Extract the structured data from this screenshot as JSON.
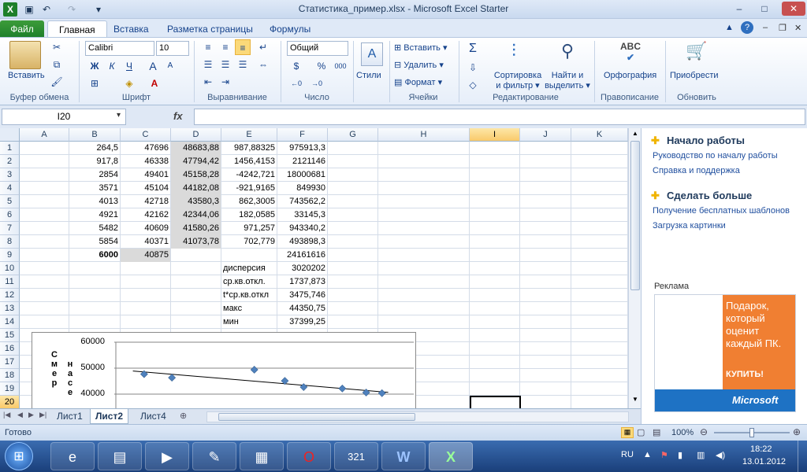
{
  "window": {
    "title": "Статистика_пример.xlsx - Microsoft Excel Starter",
    "minimize": "–",
    "maximize": "□",
    "close": "✕"
  },
  "ribbon_tabs": {
    "file": "Файл",
    "home": "Главная",
    "insert": "Вставка",
    "page_layout": "Разметка страницы",
    "formulas": "Формулы"
  },
  "ribbon": {
    "clipboard": {
      "paste": "Вставить",
      "label": "Буфер обмена"
    },
    "font": {
      "name": "Calibri",
      "size": "10",
      "bold": "Ж",
      "italic": "К",
      "underline": "Ч",
      "grow": "A",
      "shrink": "A",
      "label": "Шрифт"
    },
    "alignment": {
      "label": "Выравнивание"
    },
    "number": {
      "format": "Общий",
      "percent": "%",
      "comma": "000",
      "label": "Число"
    },
    "styles": {
      "label": "Стили"
    },
    "cells": {
      "insert": "Вставить",
      "delete": "Удалить",
      "format": "Формат",
      "label": "Ячейки"
    },
    "editing": {
      "sum": "Σ",
      "sort_filter_1": "Сортировка",
      "sort_filter_2": "и фильтр",
      "find_1": "Найти и",
      "find_2": "выделить",
      "label": "Редактирование"
    },
    "proofing": {
      "spelling": "Орфография",
      "label": "Правописание"
    },
    "update": {
      "buy": "Приобрести",
      "label": "Обновить"
    }
  },
  "formula_bar": {
    "name_box": "I20",
    "fx": "fx",
    "value": ""
  },
  "columns": [
    "A",
    "B",
    "C",
    "D",
    "E",
    "F",
    "G",
    "H",
    "I",
    "J",
    "K"
  ],
  "selected_column": "I",
  "rows": [
    "1",
    "2",
    "3",
    "4",
    "5",
    "6",
    "7",
    "8",
    "9",
    "10",
    "11",
    "12",
    "13",
    "14",
    "15",
    "16",
    "17",
    "18",
    "19",
    "20"
  ],
  "selected_row": "20",
  "cells": {
    "B": [
      "264,5",
      "917,8",
      "2854",
      "3571",
      "4013",
      "4921",
      "5482",
      "5854",
      "6000"
    ],
    "C": [
      "47696",
      "46338",
      "49401",
      "45104",
      "42718",
      "42162",
      "40609",
      "40371",
      "40875"
    ],
    "D": [
      "48683,88",
      "47794,42",
      "45158,28",
      "44182,08",
      "43580,3",
      "42344,06",
      "41580,26",
      "41073,78"
    ],
    "E": [
      "987,88325",
      "1456,4153",
      "-4242,721",
      "-921,9165",
      "862,3005",
      "182,0585",
      "971,257",
      "702,779"
    ],
    "F": [
      "975913,3",
      "2121146",
      "18000681",
      "849930",
      "743562,2",
      "33145,3",
      "943340,2",
      "493898,3",
      "24161616"
    ],
    "stats_labels": [
      "дисперсия",
      "ср.кв.откл.",
      "t*ср.кв.откл",
      "макс",
      "мин"
    ],
    "stats_values": [
      "3020202",
      "1737,873",
      "3475,746",
      "44350,75",
      "37399,25"
    ]
  },
  "chart_data": {
    "type": "scatter",
    "y_ticks": [
      "60000",
      "50000",
      "40000"
    ],
    "ylim": [
      35000,
      60000
    ],
    "ylabel_col1": [
      "С",
      "м",
      "е",
      "р"
    ],
    "ylabel_col2": [
      "н",
      "а",
      "с",
      "е"
    ],
    "points": [
      {
        "x": 264.5,
        "y": 47696
      },
      {
        "x": 917.8,
        "y": 46338
      },
      {
        "x": 2854,
        "y": 49401
      },
      {
        "x": 3571,
        "y": 45104
      },
      {
        "x": 4013,
        "y": 42718
      },
      {
        "x": 4921,
        "y": 42162
      },
      {
        "x": 5482,
        "y": 40609
      },
      {
        "x": 5854,
        "y": 40371
      }
    ],
    "trendline": [
      {
        "x": 0,
        "y": 48900
      },
      {
        "x": 6000,
        "y": 40700
      }
    ],
    "xlim": [
      -400,
      6600
    ],
    "marker_color": "#4f81bd"
  },
  "sheet_tabs": [
    "Лист1",
    "Лист2",
    "Лист4"
  ],
  "active_sheet": "Лист2",
  "task_pane": {
    "section1": "Начало работы",
    "link1": "Руководство по началу работы",
    "link2": "Справка и поддержка",
    "section2": "Сделать больше",
    "link3": "Получение бесплатных шаблонов",
    "link4": "Загрузка картинки",
    "ad_label": "Реклама",
    "ad_text": "Подарок, который оценит каждый ПК.",
    "ad_button": "КУПИТЬ!",
    "ad_brand": "Microsoft",
    "ad_color": "#f07f32"
  },
  "status": {
    "ready": "Готово",
    "zoom": "100%"
  },
  "taskbar": {
    "lang": "RU",
    "time": "18:22",
    "date": "13.01.2012"
  }
}
